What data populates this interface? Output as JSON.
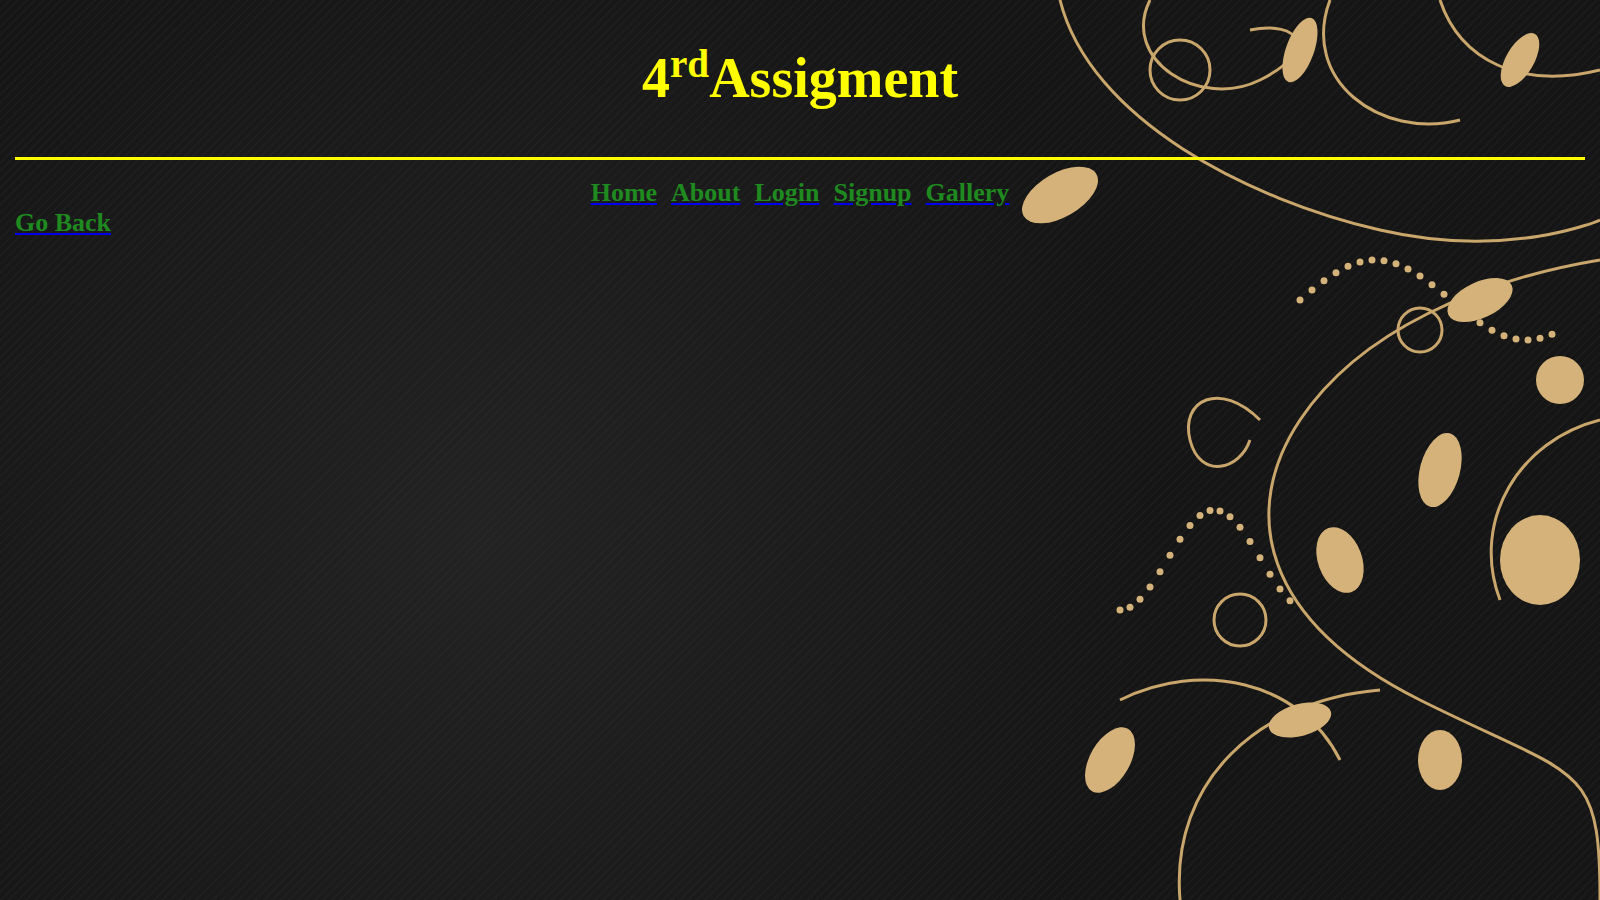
{
  "header": {
    "number": "4",
    "superscript": "rd",
    "title": "Assigment"
  },
  "nav": {
    "links": [
      {
        "label": "Home"
      },
      {
        "label": "About"
      },
      {
        "label": "Login"
      },
      {
        "label": "Signup"
      },
      {
        "label": "Gallery"
      }
    ]
  },
  "back_link": {
    "label": "Go Back"
  }
}
